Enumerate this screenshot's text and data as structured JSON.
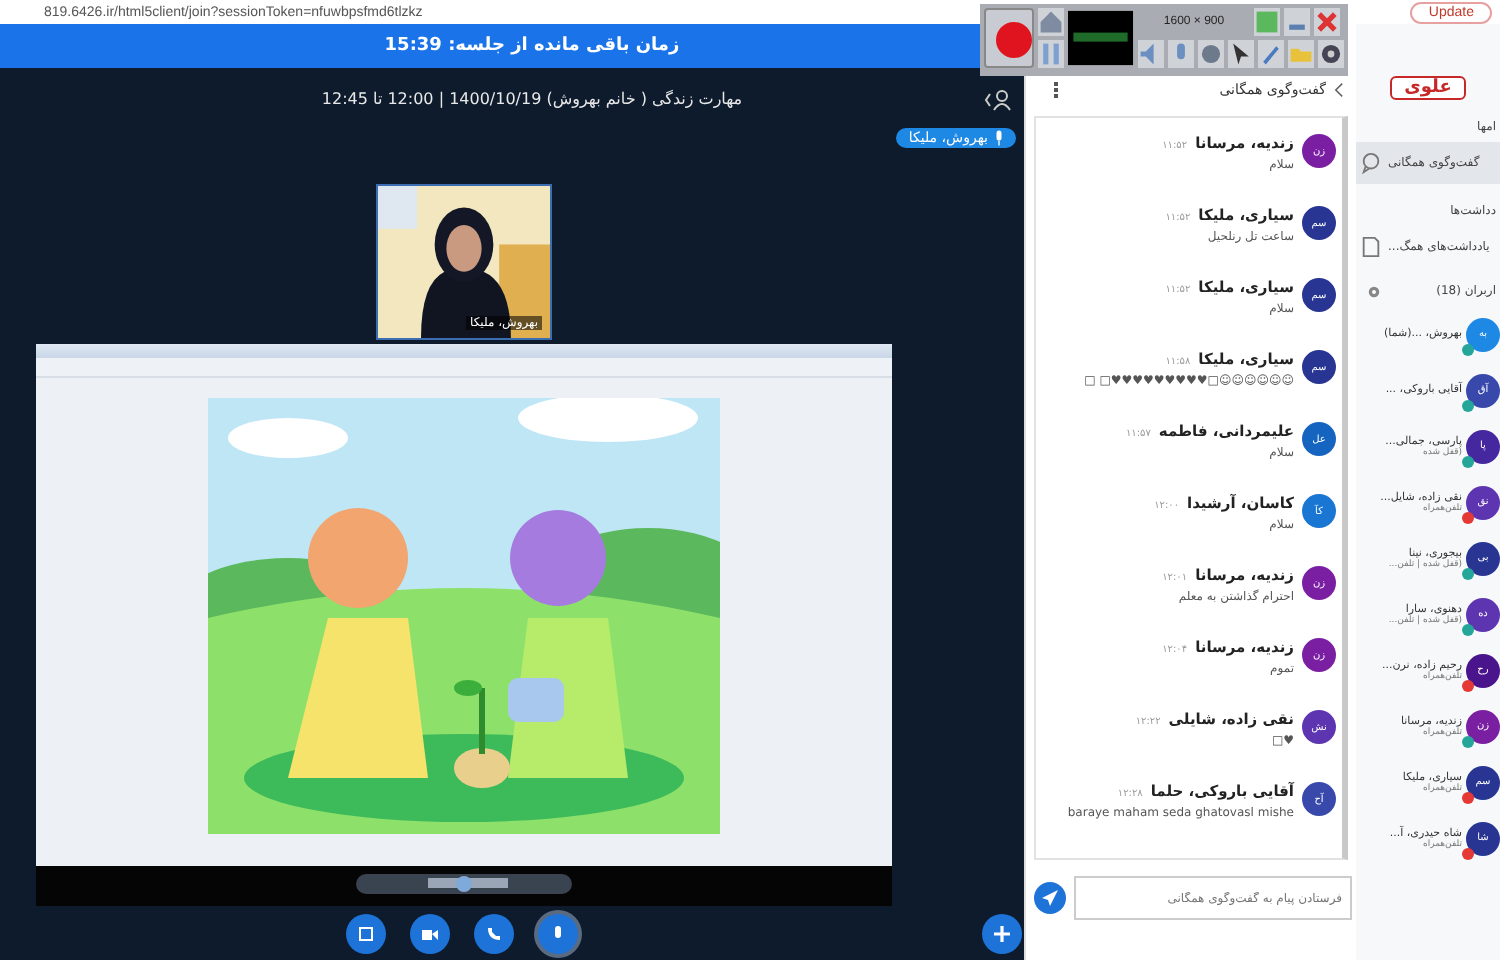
{
  "browser": {
    "url": "819.6426.ir/html5client/join?sessionToken=nfuwbpsfmd6tlzkz",
    "update_button": "Update"
  },
  "recorder": {
    "resolution": "1600 × 900"
  },
  "timer_bar": {
    "text": "زمان باقی مانده از جلسه: 15:39"
  },
  "session": {
    "title": "مهارت زندگی ( خانم بهروش) 1400/10/19 | 12:00 تا 12:45"
  },
  "speaker_badge": {
    "name": "بهروش، ملیکا"
  },
  "webcam": {
    "label": "بهروش، ملیکا"
  },
  "chat": {
    "title": "گفت‌وگوی همگانی",
    "placeholder": "فرستادن پیام به گفت‌وگوی همگانی",
    "messages": [
      {
        "initials": "زن",
        "color": "#7b1fa2",
        "name": "زندیه، مرسانا",
        "time": "۱۱:۵۲",
        "text": "سلام"
      },
      {
        "initials": "سم",
        "color": "#283593",
        "name": "سیاری، ملیکا",
        "time": "۱۱:۵۲",
        "text": "ساعت تل رنلحیل"
      },
      {
        "initials": "سم",
        "color": "#283593",
        "name": "سیاری، ملیکا",
        "time": "۱۱:۵۲",
        "text": "سلام"
      },
      {
        "initials": "سم",
        "color": "#283593",
        "name": "سیاری، ملیکا",
        "time": "۱۱:۵۸",
        "text": "☺☺☺☺☺☺□♥♥♥♥♥♥♥♥♥□ □"
      },
      {
        "initials": "عل",
        "color": "#1565c0",
        "name": "علیمردانی، فاطمه",
        "time": "۱۱:۵۷",
        "text": "سلام"
      },
      {
        "initials": "کآ",
        "color": "#1976d2",
        "name": "کاسان، آرشیدا",
        "time": "۱۲:۰۰",
        "text": "سلام"
      },
      {
        "initials": "زن",
        "color": "#7b1fa2",
        "name": "زندیه، مرسانا",
        "time": "۱۲:۰۱",
        "text": "احترام گذاشتن به معلم"
      },
      {
        "initials": "زن",
        "color": "#7b1fa2",
        "name": "زندیه، مرسانا",
        "time": "۱۲:۰۴",
        "text": "تموم"
      },
      {
        "initials": "نش",
        "color": "#5e35b1",
        "name": "نقی زاده، شایلی",
        "time": "۱۲:۲۲",
        "text": "♥□"
      },
      {
        "initials": "آح",
        "color": "#3949ab",
        "name": "آقایی باروکی، حلما",
        "time": "۱۲:۲۸",
        "text": "baraye maham seda ghatovasl mishe"
      }
    ]
  },
  "sidebar": {
    "logo": "علوی",
    "messages_heading": "امها",
    "public_chat": "گفت‌وگوی همگانی",
    "notes_heading": "دداشت‌ها",
    "shared_notes": "یادداشت‌های همگ...",
    "users_heading": "اربران (18)",
    "users": [
      {
        "initials": "به",
        "color": "#1e88e5",
        "muted": false,
        "name": "بهروش، ...(شما)"
      },
      {
        "initials": "آق",
        "color": "#3949ab",
        "muted": false,
        "name": "آقایی باروکی، ..."
      },
      {
        "initials": "پا",
        "color": "#4527a0",
        "muted": false,
        "name": "پارسی، جمالی...",
        "note": "(قفل شده"
      },
      {
        "initials": "نق",
        "color": "#5e35b1",
        "muted": true,
        "name": "نقی زاده، شایل...",
        "note": "تلفن‌همراه"
      },
      {
        "initials": "بی",
        "color": "#283593",
        "muted": false,
        "name": "بیجوری، نینا",
        "note": "(قفل شده | تلفن..."
      },
      {
        "initials": "ده",
        "color": "#5e35b1",
        "muted": false,
        "name": "دهنوی، سارا",
        "note": "(قفل شده | تلفن..."
      },
      {
        "initials": "رح",
        "color": "#4a148c",
        "muted": true,
        "name": "رحیم زاده، نرن...",
        "note": "تلفن‌همراه"
      },
      {
        "initials": "زن",
        "color": "#7b1fa2",
        "muted": false,
        "name": "زندیه، مرسانا",
        "note": "تلفن‌همراه"
      },
      {
        "initials": "سم",
        "color": "#283593",
        "muted": true,
        "name": "سیاری، ملیکا",
        "note": "تلفن‌همراه"
      },
      {
        "initials": "شا",
        "color": "#283593",
        "muted": true,
        "name": "شاه حیدری، آ...",
        "note": "تلفن‌همراه"
      }
    ]
  }
}
